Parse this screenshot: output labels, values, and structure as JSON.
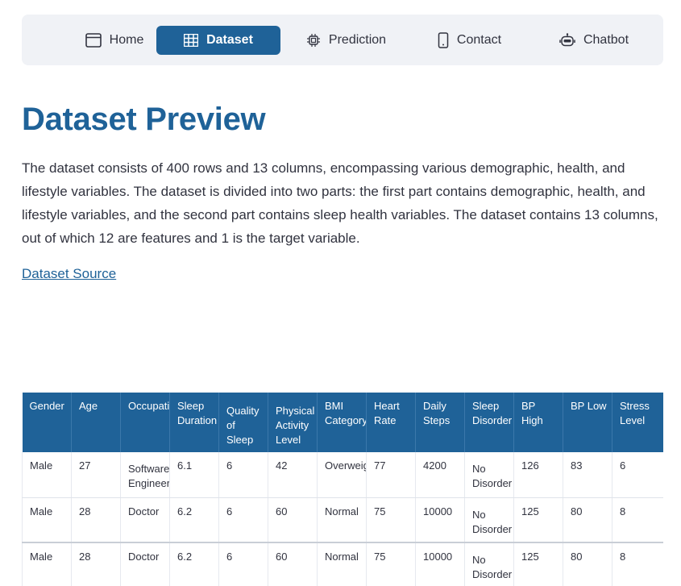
{
  "nav": {
    "items": [
      {
        "label": "Home",
        "icon": "window-icon",
        "active": false
      },
      {
        "label": "Dataset",
        "icon": "table-icon",
        "active": true
      },
      {
        "label": "Prediction",
        "icon": "cpu-icon",
        "active": false
      },
      {
        "label": "Contact",
        "icon": "phone-icon",
        "active": false
      },
      {
        "label": "Chatbot",
        "icon": "robot-icon",
        "active": false
      }
    ],
    "active_color": "#1f6298"
  },
  "page": {
    "title": "Dataset Preview",
    "description": "The dataset consists of 400 rows and 13 columns, encompassing various demographic, health, and lifestyle variables. The dataset is divided into two parts: the first part contains demographic, health, and lifestyle variables, and the second part contains sleep health variables. The dataset contains 13 columns, out of which 12 are features and 1 is the target variable.",
    "source_link": "Dataset Source"
  },
  "table": {
    "columns": [
      "Gender",
      "Age",
      "Occupation",
      "Sleep Duration",
      "Quality of Sleep",
      "Physical Activity Level",
      "BMI Category",
      "Heart Rate",
      "Daily Steps",
      "Sleep Disorder",
      "BP High",
      "BP Low",
      "Stress Level"
    ],
    "rows": [
      [
        "Male",
        "27",
        "Software Engineer",
        "6.1",
        "6",
        "42",
        "Overweight",
        "77",
        "4200",
        "No Disorder",
        "126",
        "83",
        "6"
      ],
      [
        "Male",
        "28",
        "Doctor",
        "6.2",
        "6",
        "60",
        "Normal",
        "75",
        "10000",
        "No Disorder",
        "125",
        "80",
        "8"
      ],
      [
        "Male",
        "28",
        "Doctor",
        "6.2",
        "6",
        "60",
        "Normal",
        "75",
        "10000",
        "No Disorder",
        "125",
        "80",
        "8"
      ]
    ]
  }
}
